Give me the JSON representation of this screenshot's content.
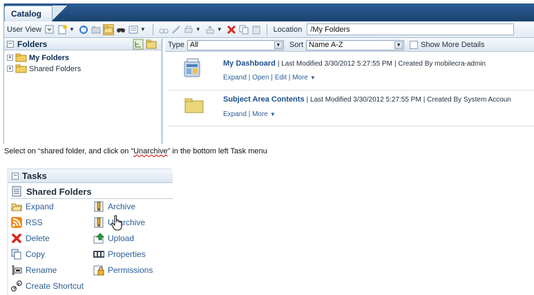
{
  "catalog": {
    "tab_label": "Catalog",
    "toolbar": {
      "user_view_label": "User View",
      "location_label": "Location",
      "location_value": "/My Folders"
    },
    "folders_pane": {
      "title": "Folders",
      "items": [
        {
          "label": "My Folders",
          "selected": true
        },
        {
          "label": "Shared Folders",
          "selected": false
        }
      ]
    },
    "filter": {
      "type_label": "Type",
      "type_value": "All",
      "sort_label": "Sort",
      "sort_value": "Name A-Z",
      "show_more_label": "Show More Details"
    },
    "items": [
      {
        "name": "My Dashboard",
        "modified": "Last Modified 3/30/2012 5:27:55 PM",
        "created": "Created By mobilecra-admin",
        "links": "Expand | Open | Edit | More",
        "icon": "dashboard-icon"
      },
      {
        "name": "Subject Area Contents",
        "modified": "Last Modified 3/30/2012 5:27:55 PM",
        "created": "Created By System Accoun",
        "links": "Expand | More",
        "icon": "folder-icon"
      }
    ]
  },
  "instruction": {
    "before": "Select on “shared folder, and click on “",
    "underlined": "Unarchive",
    "after": "” in the bottom left Task menu"
  },
  "tasks": {
    "title": "Tasks",
    "context": "Shared Folders",
    "left_items": [
      {
        "label": "Expand",
        "icon": "folder-open-icon"
      },
      {
        "label": "RSS",
        "icon": "rss-icon"
      },
      {
        "label": "Delete",
        "icon": "delete-icon"
      },
      {
        "label": "Copy",
        "icon": "copy-icon"
      },
      {
        "label": "Rename",
        "icon": "rename-icon"
      },
      {
        "label": "Create Shortcut",
        "icon": "shortcut-icon"
      }
    ],
    "right_items": [
      {
        "label": "Archive",
        "icon": "archive-icon"
      },
      {
        "label": "Unarchive",
        "icon": "unarchive-icon"
      },
      {
        "label": "Upload",
        "icon": "upload-icon"
      },
      {
        "label": "Properties",
        "icon": "properties-icon"
      },
      {
        "label": "Permissions",
        "icon": "permissions-icon"
      }
    ]
  },
  "colors": {
    "header_blue": "#1a426f",
    "link_blue": "#2a5d95",
    "title_blue": "#1d4f8c"
  }
}
